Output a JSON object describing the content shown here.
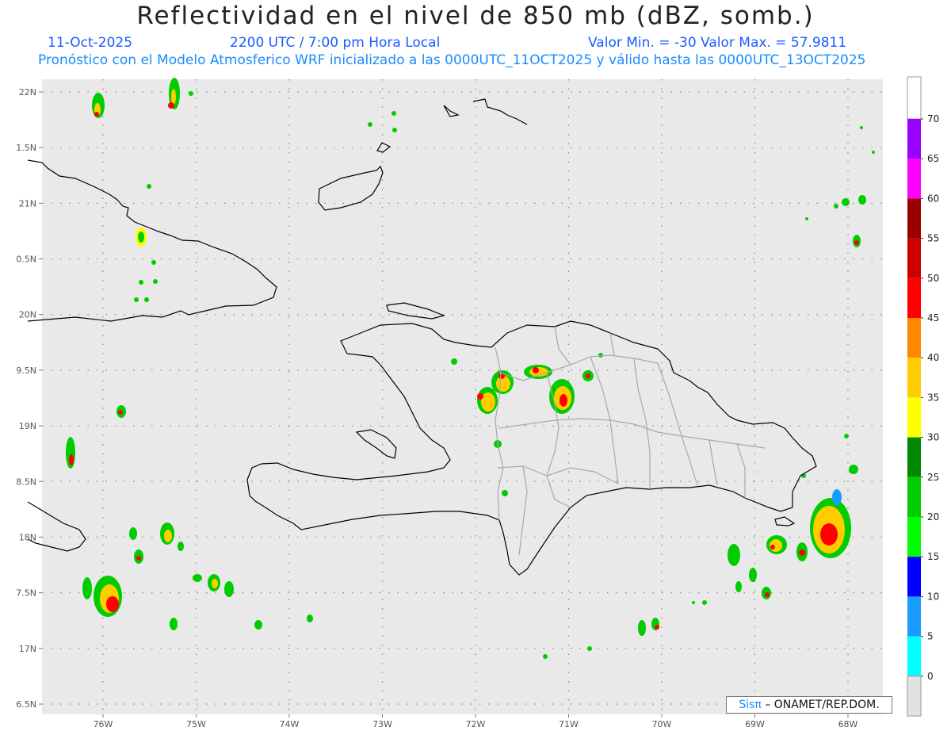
{
  "header": {
    "title": "Reflectividad en el nivel de 850 mb (dBZ, somb.)",
    "date": "11-Oct-2025",
    "time": "2200 UTC / 7:00 pm Hora Local",
    "min_max": "Valor Min. = -30  Valor Max. = 57.9811",
    "forecast_note": "Pronóstico con el Modelo Atmosferico WRF inicializado a las 0000UTC_11OCT2025 y válido hasta las  0000UTC_13OCT2025"
  },
  "map": {
    "lat_labels": [
      "22N",
      "1.5N",
      "21N",
      "0.5N",
      "20N",
      "9.5N",
      "19N",
      "8.5N",
      "18N",
      "7.5N",
      "17N",
      "6.5N"
    ],
    "lon_labels": [
      "76W",
      "75W",
      "74W",
      "73W",
      "72W",
      "71W",
      "70W",
      "69W",
      "68W"
    ],
    "lat_values": [
      22,
      21.5,
      21,
      20.5,
      20,
      19.5,
      19,
      18.5,
      18,
      17.5,
      17,
      16.5
    ],
    "lon_values": [
      -76,
      -75,
      -74,
      -73,
      -72,
      -71,
      -70,
      -69,
      -68
    ],
    "background_color": "#e9e9e9",
    "coast_color": "#000000",
    "border_color": "#a8a8a8"
  },
  "colorbar": {
    "labels": [
      "0",
      "5",
      "10",
      "15",
      "20",
      "25",
      "30",
      "35",
      "40",
      "45",
      "50",
      "55",
      "60",
      "65",
      "70"
    ],
    "colors": [
      "#00ffff",
      "#1a9cff",
      "#0000ff",
      "#00ff00",
      "#00cc00",
      "#008800",
      "#ffff00",
      "#ffcc00",
      "#ff8800",
      "#ff0000",
      "#cc0000",
      "#990000",
      "#ff00ff",
      "#9900ff"
    ]
  },
  "credit": {
    "sis": "Sisπ",
    "org": "– ONAMET/REP.DOM."
  }
}
